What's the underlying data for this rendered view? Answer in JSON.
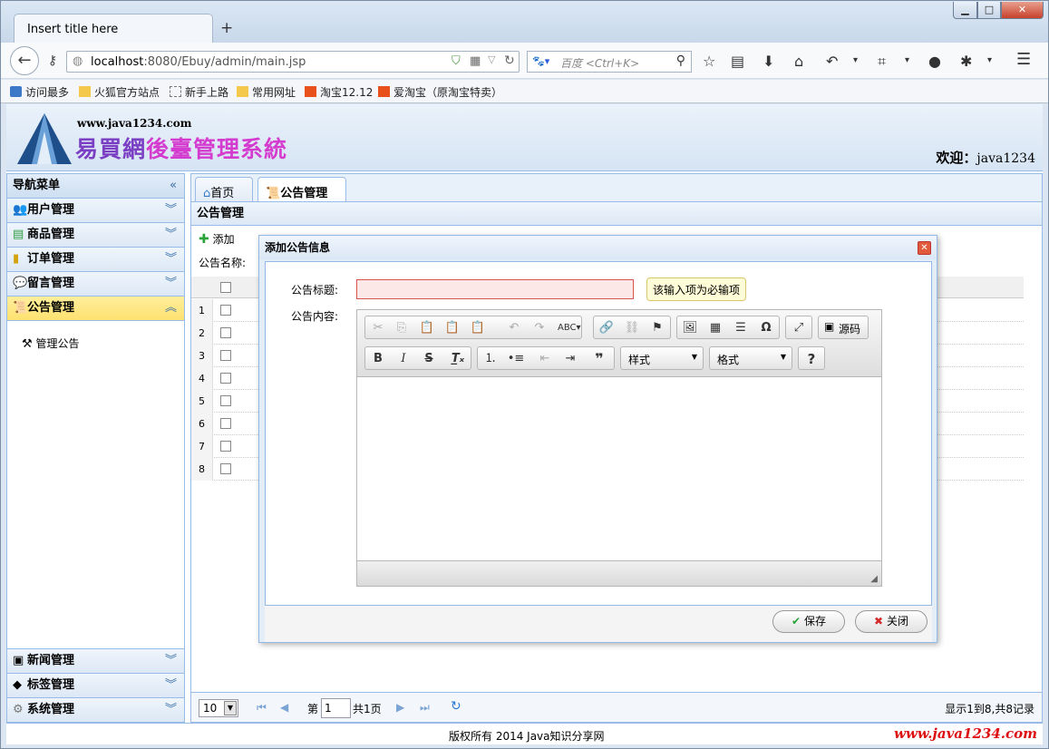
{
  "browser": {
    "tab_title": "Insert title here",
    "url_host": "localhost",
    "url_rest": ":8080/Ebuy/admin/main.jsp",
    "search_placeholder": "百度 <Ctrl+K>"
  },
  "bookmarks": [
    "访问最多",
    "火狐官方站点",
    "新手上路",
    "常用网址",
    "淘宝12.12",
    "爱淘宝（原淘宝特卖）"
  ],
  "header": {
    "site_url": "www.java1234.com",
    "brand_a": "易買網",
    "brand_b": "後臺管理系統",
    "welcome_label": "欢迎：",
    "welcome_user": "java1234"
  },
  "nav": {
    "title": "导航菜单",
    "items": [
      "用户管理",
      "商品管理",
      "订单管理",
      "留言管理",
      "公告管理"
    ],
    "sub_item": "管理公告",
    "bottom_items": [
      "新闻管理",
      "标签管理",
      "系统管理"
    ]
  },
  "tabs": [
    "首页",
    "公告管理"
  ],
  "panel": {
    "title": "公告管理",
    "add_label": "添加",
    "filter_label": "公告名称:",
    "row_numbers": [
      "1",
      "2",
      "3",
      "4",
      "5",
      "6",
      "7",
      "8"
    ]
  },
  "pager": {
    "page_size": "10",
    "page_prefix": "第",
    "page_value": "1",
    "page_suffix": "共1页",
    "summary": "显示1到8,共8记录"
  },
  "footer": {
    "copyright": "版权所有 2014 Java知识分享网",
    "url": "www.java1234.com"
  },
  "dialog": {
    "title": "添加公告信息",
    "title_label": "公告标题:",
    "content_label": "公告内容:",
    "title_value": "",
    "validation_tip": "该输入项为必输项",
    "source_label": "源码",
    "style_combo": "样式",
    "format_combo": "格式",
    "save_label": "保存",
    "close_label": "关闭"
  }
}
